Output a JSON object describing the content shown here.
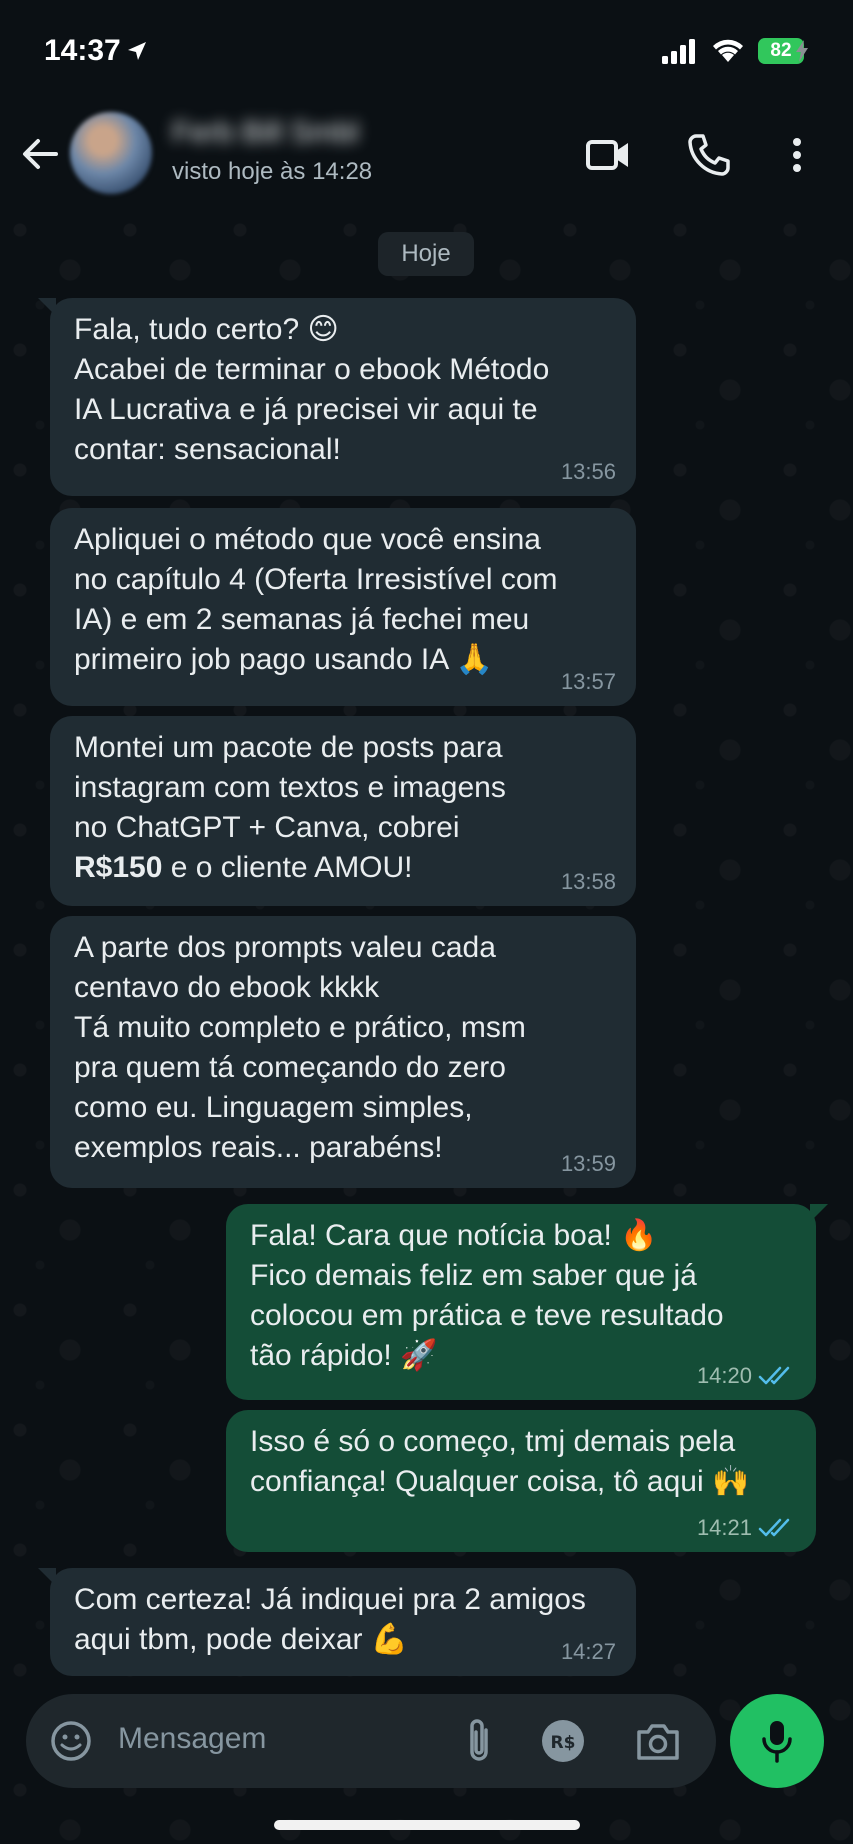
{
  "status_bar": {
    "time": "14:37",
    "battery": "82",
    "colors": {
      "battery": "#31c75c"
    }
  },
  "header": {
    "contact_name": "Ferb Bill Smbl",
    "last_seen": "visto hoje às 14:28"
  },
  "date_chip": "Hoje",
  "messages": [
    {
      "direction": "in",
      "lines": [
        "Fala, tudo certo? 😊",
        "Acabei de terminar o ebook Método",
        "IA Lucrativa e já precisei vir aqui te",
        "contar: sensacional!"
      ],
      "time": "13:56"
    },
    {
      "direction": "in",
      "lines": [
        "Apliquei o método que você ensina",
        "no capítulo 4 (Oferta Irresistível com",
        "IA) e em 2 semanas já fechei meu",
        "primeiro job pago usando IA 🙏"
      ],
      "time": "13:57"
    },
    {
      "direction": "in",
      "lines": [
        "Montei um pacote de posts para",
        "instagram com textos e imagens",
        "no ChatGPT + Canva, cobrei"
      ],
      "bold": "R$150",
      "last_line_rest": " e o cliente AMOU!",
      "time": "13:58"
    },
    {
      "direction": "in",
      "lines": [
        "A parte dos prompts valeu cada",
        "centavo do ebook kkkk",
        "Tá muito completo e prático, msm",
        "pra quem tá começando do zero",
        "como eu. Linguagem simples,",
        "exemplos reais... parabéns!"
      ],
      "time": "13:59"
    },
    {
      "direction": "out",
      "lines": [
        "Fala! Cara que notícia boa! 🔥",
        "Fico demais feliz em saber que já",
        "colocou em prática e teve resultado",
        "tão rápido! 🚀"
      ],
      "time": "14:20"
    },
    {
      "direction": "out",
      "lines": [
        "Isso é só o começo, tmj demais pela",
        "confiança! Qualquer coisa, tô aqui 🙌"
      ],
      "time": "14:21"
    },
    {
      "direction": "in",
      "lines": [
        "Com certeza! Já indiquei pra 2 amigos",
        "aqui tbm, pode deixar 💪"
      ],
      "time": "14:27"
    }
  ],
  "composer": {
    "placeholder": "Mensagem"
  },
  "colors": {
    "background": "#0b1014",
    "incoming_bubble": "#202c33",
    "outgoing_bubble": "#144d37",
    "accent": "#21c063",
    "read_ticks": "#53bdeb"
  }
}
